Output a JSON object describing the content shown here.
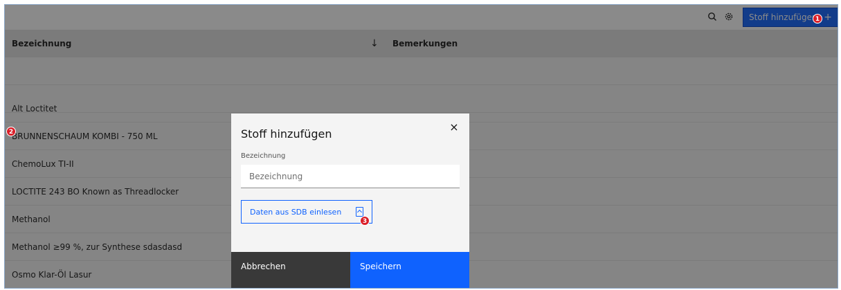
{
  "toolbar": {
    "search_icon": "search-icon",
    "settings_icon": "gear-icon",
    "add_button_label": "Stoff hinzufügen",
    "add_button_plus": "+"
  },
  "badges": {
    "b1": "1",
    "b2": "2",
    "b3": "3"
  },
  "table": {
    "headers": {
      "name": "Bezeichnung",
      "sort_indicator": "↓",
      "remarks": "Bemerkungen"
    },
    "rows": [
      {
        "name": ""
      },
      {
        "name": ""
      },
      {
        "name": "Alt Loctitet"
      },
      {
        "name": "BRUNNENSCHAUM KOMBI - 750 ML"
      },
      {
        "name": "ChemoLux TI-II"
      },
      {
        "name": "LOCTITE 243 BO Known as Threadlocker"
      },
      {
        "name": "Methanol"
      },
      {
        "name": "Methanol ≥99 %, zur Synthese sdasdasd"
      },
      {
        "name": "Osmo Klar-Öl Lasur"
      }
    ]
  },
  "modal": {
    "title": "Stoff hinzufügen",
    "close": "×",
    "field_label": "Bezeichnung",
    "field_placeholder": "Bezeichnung",
    "field_value": "",
    "sdb_button_label": "Daten aus SDB einlesen",
    "cancel_label": "Abbrechen",
    "save_label": "Speichern"
  },
  "colors": {
    "primary": "#0f62fe",
    "badge": "#da1e28",
    "cancel_bg": "#393939"
  }
}
